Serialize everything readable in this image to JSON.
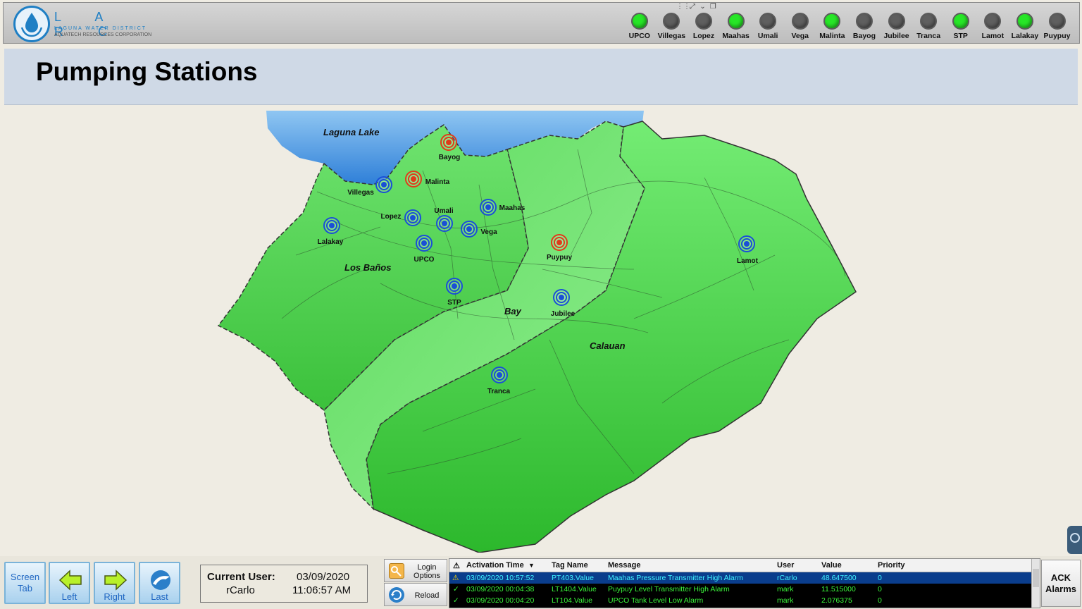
{
  "logo": {
    "letters": "L A R C",
    "sub1": "LAGUNA WATER DISTRICT",
    "sub2": "AQUATECH RESOURCES CORPORATION"
  },
  "window_controls": [
    "⤢",
    "⌄",
    "❐"
  ],
  "station_lights": [
    {
      "name": "UPCO",
      "state": "on",
      "color": "#27e627"
    },
    {
      "name": "Villegas",
      "state": "off",
      "color": "#5f5f5f"
    },
    {
      "name": "Lopez",
      "state": "off",
      "color": "#5f5f5f"
    },
    {
      "name": "Maahas",
      "state": "on",
      "color": "#27e627"
    },
    {
      "name": "Umali",
      "state": "off",
      "color": "#5f5f5f"
    },
    {
      "name": "Vega",
      "state": "off",
      "color": "#5f5f5f"
    },
    {
      "name": "Malinta",
      "state": "on",
      "color": "#27e627"
    },
    {
      "name": "Bayog",
      "state": "off",
      "color": "#5f5f5f"
    },
    {
      "name": "Jubilee",
      "state": "off",
      "color": "#5f5f5f"
    },
    {
      "name": "Tranca",
      "state": "off",
      "color": "#5f5f5f"
    },
    {
      "name": "STP",
      "state": "on",
      "color": "#27e627"
    },
    {
      "name": "Lamot",
      "state": "off",
      "color": "#5f5f5f"
    },
    {
      "name": "Lalakay",
      "state": "on",
      "color": "#27e627"
    },
    {
      "name": "Puypuy",
      "state": "off",
      "color": "#5f5f5f"
    }
  ],
  "page_title": "Pumping Stations",
  "map": {
    "lake_label": "Laguna Lake",
    "regions": [
      "Los Baños",
      "Bay",
      "Calauan"
    ],
    "stations": [
      {
        "name": "Bayog",
        "status": "alarm"
      },
      {
        "name": "Malinta",
        "status": "alarm"
      },
      {
        "name": "Villegas",
        "status": "normal"
      },
      {
        "name": "Lopez",
        "status": "normal"
      },
      {
        "name": "Umali",
        "status": "normal"
      },
      {
        "name": "Maahas",
        "status": "normal"
      },
      {
        "name": "Vega",
        "status": "normal"
      },
      {
        "name": "Lalakay",
        "status": "normal"
      },
      {
        "name": "UPCO",
        "status": "normal"
      },
      {
        "name": "STP",
        "status": "normal"
      },
      {
        "name": "Puypuy",
        "status": "alarm"
      },
      {
        "name": "Jubilee",
        "status": "normal"
      },
      {
        "name": "Lamot",
        "status": "normal"
      },
      {
        "name": "Tranca",
        "status": "normal"
      }
    ],
    "colors": {
      "normal": "#1a4fd6",
      "alarm": "#e03a1a"
    }
  },
  "nav": {
    "screen_tab": "Screen Tab",
    "left": "Left",
    "right": "Right",
    "last": "Last"
  },
  "user": {
    "label": "Current User:",
    "name": "rCarlo",
    "date": "03/09/2020",
    "time": "11:06:57 AM"
  },
  "buttons": {
    "login_options": "Login Options",
    "reload": "Reload",
    "ack_alarms": "ACK Alarms"
  },
  "alarms": {
    "columns": [
      "Activation Time",
      "Tag Name",
      "Message",
      "User",
      "Value",
      "Priority"
    ],
    "sort_icon": "▼",
    "rows": [
      {
        "time": "03/09/2020 10:57:52",
        "tag": "PT403.Value",
        "message": "Maahas Pressure Transmitter High Alarm",
        "user": "rCarlo",
        "value": "48.647500",
        "priority": "0",
        "icon": "warning-icon",
        "selected": true
      },
      {
        "time": "03/09/2020 00:04:38",
        "tag": "LT1404.Value",
        "message": "Puypuy Level Transmitter High Alarm",
        "user": "mark",
        "value": "11.515000",
        "priority": "0",
        "icon": "check-icon",
        "selected": false
      },
      {
        "time": "03/09/2020 00:04:20",
        "tag": "LT104.Value",
        "message": "UPCO Tank Level Low Alarm",
        "user": "mark",
        "value": "2.076375",
        "priority": "0",
        "icon": "check-icon",
        "selected": false
      }
    ]
  }
}
